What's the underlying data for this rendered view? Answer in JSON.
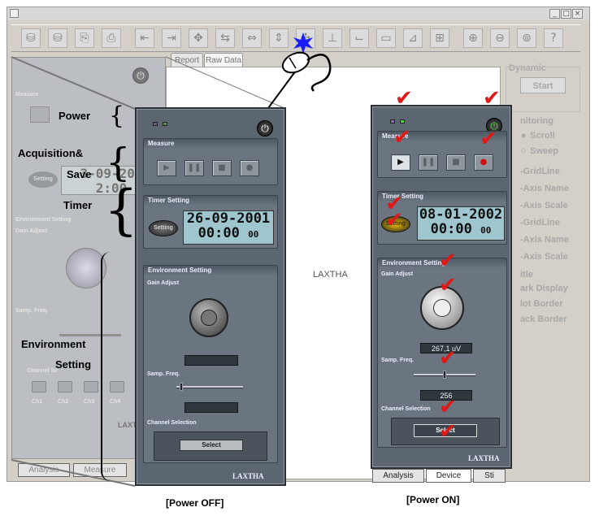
{
  "app": {
    "close_glyph": "×",
    "min_glyph": "_",
    "max_glyph": "□"
  },
  "toolbar": {
    "icons": [
      "save-icon",
      "save-all-icon",
      "copy-icon",
      "print-icon",
      "arrows-left-icon",
      "arrows-right-icon",
      "arrows-expand-icon",
      "arrows-in-icon",
      "arrows-out-icon",
      "fit-icon",
      "cursor-move-icon",
      "axis-icon",
      "axis-2-icon",
      "graph-icon",
      "graph-2-icon",
      "graph-3-icon",
      "zoom-in-icon",
      "zoom-out-icon",
      "zoom-reset-icon",
      "help-icon"
    ],
    "glyphs": [
      "⛁",
      "⛁",
      "⎘",
      "⎙",
      "⇤",
      "⇥",
      "✥",
      "⇆",
      "⇔",
      "⇕",
      "✣",
      "⊥",
      "⌙",
      "▭",
      "⊿",
      "⊞",
      "⊕",
      "⊖",
      "⊚",
      "?"
    ]
  },
  "tabs": {
    "report": "Report",
    "raw_data": "Raw Data"
  },
  "canvas": {
    "watermark": "LAXTHA"
  },
  "sidebar": {
    "dynamic": "Dynamic",
    "start": "Start",
    "monitoring": "nitoring",
    "scroll": "Scroll",
    "sweep": "Sweep",
    "items": [
      "-GridLine",
      "-Axis Name",
      "-Axis Scale",
      "-GridLine",
      "-Axis Name",
      "-Axis Scale",
      "itle",
      "ark Display",
      "lot Border",
      "ack Border"
    ]
  },
  "annotations": {
    "power": "Power",
    "acquisition": "Acquisition&",
    "save": "Save",
    "timer": "Timer",
    "environment": "Environment",
    "setting": "Setting",
    "brace": "{"
  },
  "panel_off": {
    "measure": "Measure",
    "timer_setting": "Timer Setting",
    "setting_btn": "Setting",
    "date": "26-09-2001",
    "time": "00:00",
    "sec": "00",
    "env_setting": "Environment Setting",
    "gain_adjust": "Gain Adjust",
    "samp_freq": "Samp. Freq.",
    "channel_selection": "Channel Selection",
    "select": "Select",
    "logo": "LAXTHA",
    "power_glyph": "⏻",
    "play": "▶",
    "pause": "❚❚",
    "stop": "■",
    "rec": "●"
  },
  "panel_on": {
    "measure": "Measure",
    "timer_setting": "Timer Setting",
    "setting_btn": "Setting",
    "date": "08-01-2002",
    "time": "00:00",
    "sec": "00",
    "env_setting": "Environment Setting",
    "gain_adjust": "Gain Adjust",
    "gain_value": "267,1 uV",
    "samp_freq": "Samp. Freq.",
    "freq_value": "256",
    "channel_selection": "Channel Selection",
    "select": "Select",
    "logo": "LAXTHA",
    "power_glyph": "⏻",
    "play": "▶",
    "pause": "❚❚",
    "stop": "■",
    "rec": "●"
  },
  "faded_panel": {
    "measure": "Measure",
    "env_setting": "Environment Setting",
    "gain_adjust": "Gain Adjust",
    "samp_freq": "Samp. Freq.",
    "channel_se": "Channel Se",
    "channels": [
      "Ch1",
      "Ch2",
      "Ch3",
      "Ch4"
    ],
    "setting_btn": "Setting",
    "lcd_partial": "2:00",
    "lcd_date": "3-09-200",
    "logo": "LAXTHA"
  },
  "bottom_tabs_on": {
    "analysis": "Analysis",
    "device": "Device",
    "sti": "Sti"
  },
  "bottom_tabs_off": {
    "analysis": "Analysis",
    "measure": "Measure"
  },
  "captions": {
    "off": "[Power OFF]",
    "on": "[Power ON]"
  },
  "check_glyph": "✔",
  "colors": {
    "check": "#e01818",
    "lcd": "#9fc6cf",
    "panel": "#5c6670"
  }
}
